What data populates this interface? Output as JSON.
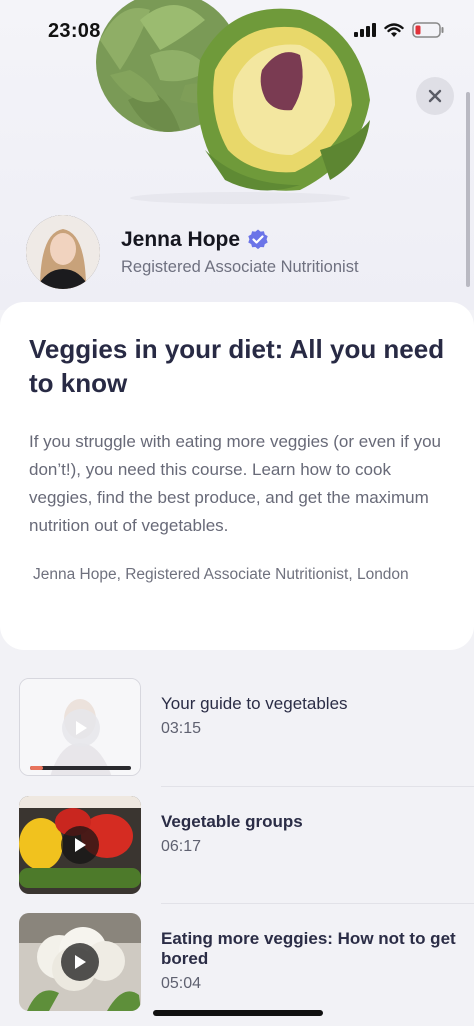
{
  "status": {
    "time": "23:08"
  },
  "author": {
    "name": "Jenna Hope",
    "role": "Registered Associate Nutritionist"
  },
  "course": {
    "title": "Veggies in your diet: All you need to know",
    "description": "If you struggle with eating more veggies (or even if you don’t!), you need this course. Learn how to cook veggies, find the best produce, and get the maximum nutrition out of vegetables.",
    "credit": "Jenna Hope, Registered Associate Nutritionist, London"
  },
  "lessons": [
    {
      "title": "Your guide to vegetables",
      "duration": "03:15",
      "progress": 0.13,
      "bold": false
    },
    {
      "title": "Vegetable groups",
      "duration": "06:17",
      "bold": true
    },
    {
      "title": "Eating more veggies: How not to get bored",
      "duration": "05:04",
      "bold": true
    }
  ],
  "colors": {
    "accent_verified": "#6b74e8",
    "progress_fill": "#e8735c",
    "title_text": "#282a44"
  },
  "icons": [
    "close-icon",
    "verified-badge-icon",
    "play-icon",
    "signal-icon",
    "wifi-icon",
    "battery-icon"
  ]
}
